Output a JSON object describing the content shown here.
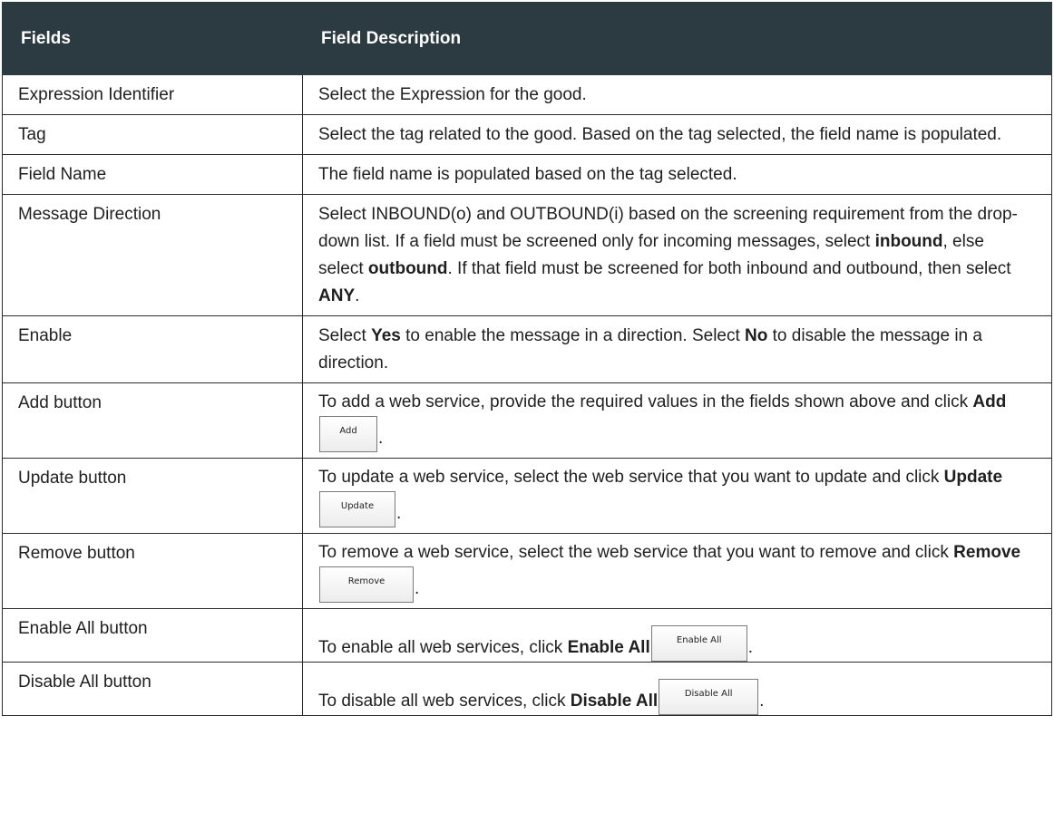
{
  "table": {
    "headers": [
      "Fields",
      "Field Description"
    ],
    "rows": [
      {
        "field": "Expression Identifier",
        "desc": "Select the Expression for the good."
      },
      {
        "field": "Tag",
        "desc": "Select the tag related to the good. Based on the tag selected, the field name is populated."
      },
      {
        "field": "Field Name",
        "desc": "The field name is populated based on the tag selected."
      },
      {
        "field": "Message Direction",
        "desc_parts": [
          "Select INBOUND(o) and OUTBOUND(i) based on the screening requirement from the drop-down list. If a field must be screened only for incoming messages, select ",
          "inbound",
          ", else select ",
          "outbound",
          ". If that field must be screened for both inbound and outbound, then select ",
          "ANY",
          "."
        ]
      },
      {
        "field": "Enable",
        "desc_parts": [
          "Select ",
          "Yes",
          " to enable the message in a direction. Select ",
          "No",
          " to disable the message in a direction."
        ]
      },
      {
        "field": "Add button",
        "desc_parts": [
          "To add a web service, provide the required values in the fields shown above and click ",
          "Add",
          "."
        ],
        "button_label": "Add"
      },
      {
        "field": "Update button",
        "desc_parts": [
          "To update a web service, select the web service that you want to update and click ",
          "Update",
          "."
        ],
        "button_label": "Update"
      },
      {
        "field": "Remove button",
        "desc_parts": [
          "To remove a web service, select the web service that you want to remove and click ",
          "Remove",
          "."
        ],
        "button_label": "Remove"
      },
      {
        "field": "Enable All button",
        "desc_parts": [
          "To enable all web services, click ",
          "Enable All",
          "."
        ],
        "button_label": "Enable All"
      },
      {
        "field": "Disable All button",
        "desc_parts": [
          "To disable all web services, click ",
          "Disable All",
          "."
        ],
        "button_label": "Disable All"
      }
    ]
  },
  "colors": {
    "header_bg": "#2c3a41",
    "header_text": "#ffffff",
    "border": "#2b2b2b"
  }
}
